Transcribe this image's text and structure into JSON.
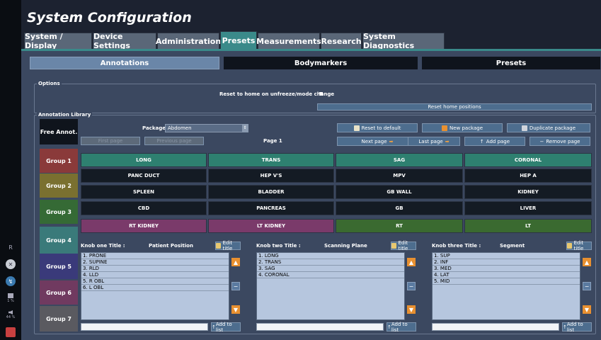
{
  "app": {
    "title": "System Configuration"
  },
  "tabs": [
    {
      "label": "System / Display",
      "active": false
    },
    {
      "label": "Device Settings",
      "active": false
    },
    {
      "label": "Administration",
      "active": false
    },
    {
      "label": "Presets",
      "active": true
    },
    {
      "label": "Measurements",
      "active": false
    },
    {
      "label": "Research",
      "active": false
    },
    {
      "label": "System Diagnostics",
      "active": false
    }
  ],
  "subtabs": [
    {
      "label": "Annotations",
      "active": true
    },
    {
      "label": "Bodymarkers",
      "active": false
    },
    {
      "label": "Presets",
      "active": false
    }
  ],
  "options": {
    "label": "Options",
    "reset_home_label": "Reset to home on unfreeze/mode change",
    "reset_home_checked": true,
    "reset_positions_label": "Reset home positions"
  },
  "library": {
    "label": "Annotation Library",
    "free_annot_label": "Free Annot.",
    "package_label": "Package",
    "package_value": "Abdomen",
    "page_label": "Page 1",
    "buttons": {
      "reset_default": "Reset to default",
      "new_package": "New package",
      "duplicate_package": "Duplicate package",
      "first_page": "First page",
      "previous_page": "Previous page",
      "next_page": "Next page",
      "last_page": "Last page",
      "add_page": "Add page",
      "remove_page": "Remove page"
    },
    "groups": [
      {
        "label": "Group 1",
        "color": "#8a3a3a"
      },
      {
        "label": "Group 2",
        "color": "#7a7030"
      },
      {
        "label": "Group 3",
        "color": "#356a35"
      },
      {
        "label": "Group 4",
        "color": "#3a7a7a"
      },
      {
        "label": "Group 5",
        "color": "#3a3a7a"
      },
      {
        "label": "Group 6",
        "color": "#703a60"
      },
      {
        "label": "Group 7",
        "color": "#5a5a60"
      }
    ],
    "grid": [
      {
        "cells": [
          "LONG",
          "TRANS",
          "SAG",
          "CORONAL"
        ],
        "color": "#2e8070"
      },
      {
        "cells": [
          "PANC DUCT",
          "HEP V'S",
          "MPV",
          "HEP A"
        ],
        "color": "#141b24"
      },
      {
        "cells": [
          "SPLEEN",
          "BLADDER",
          "GB WALL",
          "KIDNEY"
        ],
        "color": "#141b24"
      },
      {
        "cells": [
          "CBD",
          "PANCREAS",
          "GB",
          "LIVER"
        ],
        "color": "#141b24"
      },
      {
        "cells": [
          "RT KIDNEY",
          "LT KIDNEY",
          "RT",
          "LT"
        ],
        "colors": [
          "#7a3a6a",
          "#7a3a6a",
          "#3a6a30",
          "#3a6a30"
        ]
      }
    ]
  },
  "knobs": [
    {
      "title_label": "Knob one Title :",
      "title_value": "Patient Position",
      "edit_label": "Edit title",
      "add_label": "Add to list",
      "input_value": "",
      "items": [
        "1. PRONE",
        "2. SUPINE",
        "3. RLD",
        "4. LLD",
        "5. R OBL",
        "6. L OBL"
      ]
    },
    {
      "title_label": "Knob two Title :",
      "title_value": "Scanning Plane",
      "edit_label": "Edit title",
      "add_label": "Add to list",
      "input_value": "",
      "items": [
        "1. LONG",
        "2. TRANS",
        "3. SAG",
        "4. CORONAL"
      ]
    },
    {
      "title_label": "Knob three Title :",
      "title_value": "Segment",
      "edit_label": "Edit title",
      "add_label": "Add to list",
      "input_value": "",
      "items": [
        "1. SUP",
        "2. INF",
        "3. MED",
        "4. LAT",
        "5. MID"
      ]
    }
  ],
  "sidebar": {
    "items": [
      {
        "icon": "user-r-icon",
        "text": "R"
      },
      {
        "icon": "close-circle-icon",
        "text": ""
      },
      {
        "icon": "probe-icon",
        "text": ""
      },
      {
        "icon": "printer-icon",
        "text": "1 %"
      },
      {
        "icon": "volume-icon",
        "text": "44 %"
      },
      {
        "icon": "settings-icon",
        "text": ""
      }
    ]
  }
}
